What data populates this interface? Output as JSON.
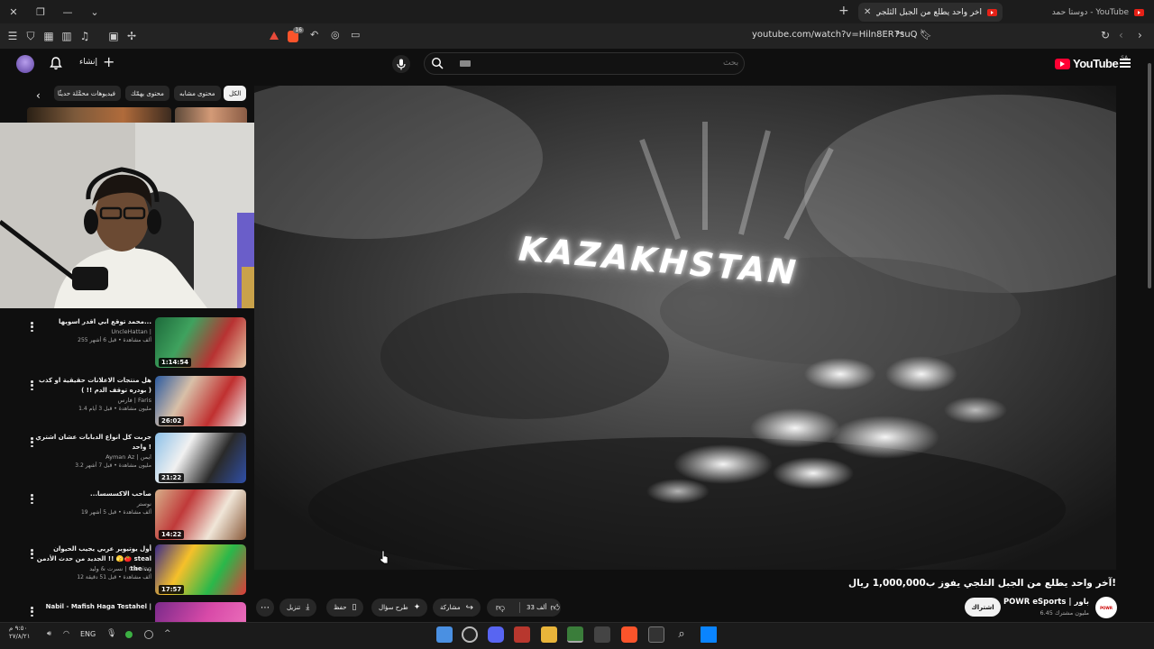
{
  "browser": {
    "active_tab_title": "آخر واحد يطلع من الجبل الثلجي يفو",
    "inactive_tab_title": "دوستا حمد - YouTube",
    "url": "youtube.com/watch?v=Hiln8ER7suQ",
    "brave_badge": "16"
  },
  "header": {
    "create_label": "إنشاء",
    "search_placeholder": "بحث",
    "logo_text": "YouTube",
    "logo_region": "SA"
  },
  "chips": [
    {
      "label": "الكل",
      "active": true
    },
    {
      "label": "محتوى مشابه",
      "active": false
    },
    {
      "label": "محتوى يهمّك",
      "active": false
    },
    {
      "label": "فيديوهات محمَّلة حديثًا",
      "active": false
    }
  ],
  "recommendations": [
    {
      "title": "محمد توقع ابي اقدر اسويها...",
      "channel": "UncleHattan |",
      "meta": "255 ألف مشاهدة • قبل 6 أشهر",
      "duration": "1:14:54"
    },
    {
      "title": "هل منتجات الاعلانات حقيقية او كذب ( بودره توقف الدم !! )",
      "channel": "فارس | Faris",
      "meta": "1.4 مليون مشاهدة • قبل 3 أيام",
      "duration": "26:02"
    },
    {
      "title": "جربت كل انواع الدبابات عشان اشتري واحد !",
      "channel": "Ayman Az | ايمن",
      "meta": "3.2 مليون مشاهدة • قبل 7 أشهر",
      "duration": "21:22"
    },
    {
      "title": "...صاحب الاكسسسا",
      "channel": "نوستر",
      "meta": "19 ألف مشاهدة • قبل 5 أشهر",
      "duration": "14:22"
    },
    {
      "title": "أول يوتيوبر عربي يجيب الحيوان الجديد من حدث الأدمن !! 🫣🍅 steal the ...",
      "channel": "نسرت & وليد | Gaming",
      "meta": "12 ألف مشاهدة • قبل 51 دقيقة",
      "duration": "17:57"
    },
    {
      "title": "Nabil - Mafish Haga Testahel |",
      "channel": "",
      "meta": "",
      "duration": ""
    }
  ],
  "video": {
    "overlay_text": "KAZAKHSTAN",
    "title": "آخر واحد يطلع من الجبل الثلجي يفوز ب1,000,000 ريال!",
    "channel_name": "POWR eSports | باور",
    "channel_avatar_text": "POWR",
    "subscribers": "6.45 مليون مشترك",
    "subscribe_label": "اشتراك",
    "actions": {
      "like_count": "33 ألف",
      "share_label": "مشاركة",
      "ask_label": "طرح سؤال",
      "save_label": "حفظ",
      "download_label": "تنزيل"
    }
  },
  "taskbar": {
    "time": "٩:٥٠ م",
    "date": "٢٧/٨/٢١",
    "language": "ENG"
  }
}
